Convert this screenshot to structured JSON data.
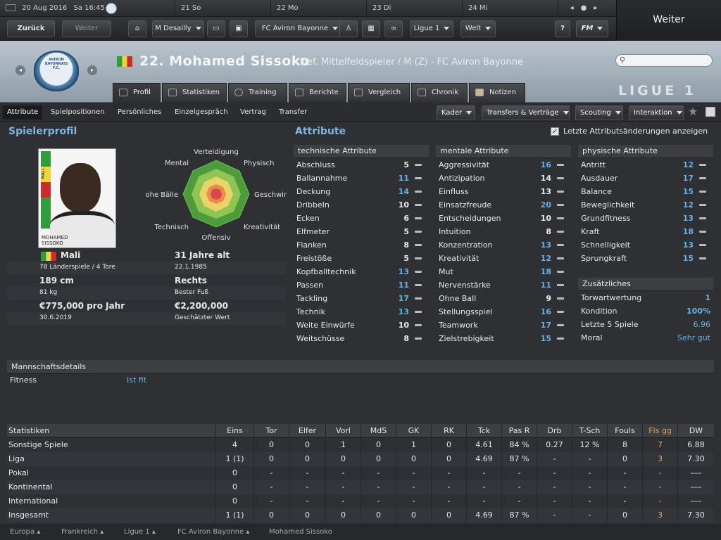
{
  "datebar": {
    "current_date": "20 Aug 2016",
    "current_time": "Sa 16:45",
    "days": [
      "21 So",
      "22 Mo",
      "23 Di",
      "24 Mi"
    ]
  },
  "nav": {
    "back": "Zurück",
    "forward": "Weiter",
    "manager": "M Desailly",
    "club": "FC Aviron Bayonne",
    "league": "Ligue 1",
    "world": "Welt",
    "help": "?",
    "fm": "FM",
    "continue": "Weiter"
  },
  "header": {
    "player_name": "22. Mohamed Sissoko",
    "player_subtitle": "Def. Mittelfeldspieler / M (Z) - FC Aviron Bayonne",
    "ligue": "LIGUE 1",
    "crest_text": "AVIRON BAYONNAIS F.C."
  },
  "tabs": [
    "Profil",
    "Statistiken",
    "Training",
    "Berichte",
    "Vergleich",
    "Chronik",
    "Notizen"
  ],
  "subnav": [
    "Attribute",
    "Spielpositionen",
    "Persönliches",
    "Einzelgespräch",
    "Vertrag",
    "Transfer"
  ],
  "dropdowns": [
    "Kader",
    "Transfers & Verträge",
    "Scouting",
    "Interaktion"
  ],
  "profile": {
    "title": "Spielerprofil",
    "photo_caption_1": "MOHAMED",
    "photo_caption_2": "SISSOKO",
    "photo_flag_text": "MALI",
    "radar_labels": [
      "Verteidigung",
      "Physisch",
      "Geschwir",
      "Kreativität",
      "Offensiv",
      "Technisch",
      "ohe Bälle",
      "Mental"
    ],
    "nation": "Mali",
    "caps": "78 Länderspiele / 4 Tore",
    "age": "31 Jahre alt",
    "dob": "22.1.1985",
    "height": "189 cm",
    "weight": "81 kg",
    "foot": "Rechts",
    "foot_label": "Bester Fuß",
    "wage": "€775,000 pro Jahr",
    "contract_end": "30.6.2019",
    "value": "€2,200,000",
    "value_label": "Geschätzter Wert"
  },
  "attributes": {
    "title": "Attribute",
    "show_changes": "Letzte Attributsänderungen anzeigen",
    "technical_head": "technische Attribute",
    "technical": [
      {
        "name": "Abschluss",
        "value": "5",
        "hi": false
      },
      {
        "name": "Ballannahme",
        "value": "11",
        "hi": true
      },
      {
        "name": "Deckung",
        "value": "14",
        "hi": true
      },
      {
        "name": "Dribbeln",
        "value": "10",
        "hi": false
      },
      {
        "name": "Ecken",
        "value": "6",
        "hi": false
      },
      {
        "name": "Elfmeter",
        "value": "5",
        "hi": false
      },
      {
        "name": "Flanken",
        "value": "8",
        "hi": false
      },
      {
        "name": "Freistöße",
        "value": "5",
        "hi": false
      },
      {
        "name": "Kopfballtechnik",
        "value": "13",
        "hi": true
      },
      {
        "name": "Passen",
        "value": "11",
        "hi": true
      },
      {
        "name": "Tackling",
        "value": "17",
        "hi": true
      },
      {
        "name": "Technik",
        "value": "13",
        "hi": true
      },
      {
        "name": "Weite Einwürfe",
        "value": "10",
        "hi": false
      },
      {
        "name": "Weitschüsse",
        "value": "8",
        "hi": false
      }
    ],
    "mental_head": "mentale Attribute",
    "mental": [
      {
        "name": "Aggressivität",
        "value": "16",
        "hi": true
      },
      {
        "name": "Antizipation",
        "value": "14",
        "hi": false
      },
      {
        "name": "Einfluss",
        "value": "13",
        "hi": false
      },
      {
        "name": "Einsatzfreude",
        "value": "20",
        "hi": true
      },
      {
        "name": "Entscheidungen",
        "value": "10",
        "hi": false
      },
      {
        "name": "Intuition",
        "value": "8",
        "hi": false
      },
      {
        "name": "Konzentration",
        "value": "13",
        "hi": true
      },
      {
        "name": "Kreativität",
        "value": "12",
        "hi": true
      },
      {
        "name": "Mut",
        "value": "18",
        "hi": true
      },
      {
        "name": "Nervenstärke",
        "value": "11",
        "hi": true
      },
      {
        "name": "Ohne Ball",
        "value": "9",
        "hi": false
      },
      {
        "name": "Stellungsspiel",
        "value": "16",
        "hi": true
      },
      {
        "name": "Teamwork",
        "value": "17",
        "hi": true
      },
      {
        "name": "Zielstrebigkeit",
        "value": "15",
        "hi": true
      }
    ],
    "physical_head": "physische Attribute",
    "physical": [
      {
        "name": "Antritt",
        "value": "12",
        "hi": true
      },
      {
        "name": "Ausdauer",
        "value": "17",
        "hi": true
      },
      {
        "name": "Balance",
        "value": "15",
        "hi": true
      },
      {
        "name": "Beweglichkeit",
        "value": "12",
        "hi": true
      },
      {
        "name": "Grundfitness",
        "value": "13",
        "hi": true
      },
      {
        "name": "Kraft",
        "value": "18",
        "hi": true
      },
      {
        "name": "Schnelligkeit",
        "value": "13",
        "hi": true
      },
      {
        "name": "Sprungkraft",
        "value": "15",
        "hi": true
      }
    ],
    "extra_head": "Zusätzliches",
    "extra": [
      {
        "name": "Torwartwertung",
        "value": "1"
      },
      {
        "name": "Kondition",
        "value": "100%"
      },
      {
        "name": "Letzte 5 Spiele",
        "value": "6.96"
      },
      {
        "name": "Moral",
        "value": "Sehr gut"
      }
    ]
  },
  "team": {
    "head": "Mannschaftsdetails",
    "fitness_label": "Fitness",
    "fitness_value": "Ist fit"
  },
  "stats": {
    "columns": [
      "Statistiken",
      "Eins",
      "Tor",
      "Elfer",
      "Vorl",
      "MdS",
      "GK",
      "RK",
      "Tck",
      "Pas R",
      "Drb",
      "T-Sch",
      "Fouls",
      "Fls gg",
      "DW"
    ],
    "rows": [
      [
        "Sonstige Spiele",
        "4",
        "0",
        "0",
        "1",
        "0",
        "1",
        "0",
        "4.61",
        "84 %",
        "0.27",
        "12 %",
        "8",
        "7",
        "6.88"
      ],
      [
        "Liga",
        "1 (1)",
        "0",
        "0",
        "0",
        "0",
        "0",
        "0",
        "4.69",
        "87 %",
        "-",
        "-",
        "0",
        "3",
        "7.30"
      ],
      [
        "Pokal",
        "0",
        "-",
        "-",
        "-",
        "-",
        "-",
        "-",
        "-",
        "-",
        "-",
        "-",
        "-",
        "-",
        "----"
      ],
      [
        "Kontinental",
        "0",
        "-",
        "-",
        "-",
        "-",
        "-",
        "-",
        "-",
        "-",
        "-",
        "-",
        "-",
        "-",
        "----"
      ],
      [
        "International",
        "0",
        "-",
        "-",
        "-",
        "-",
        "-",
        "-",
        "-",
        "-",
        "-",
        "-",
        "-",
        "-",
        "----"
      ],
      [
        "Insgesamt",
        "1 (1)",
        "0",
        "0",
        "0",
        "0",
        "0",
        "0",
        "4.69",
        "87 %",
        "-",
        "-",
        "0",
        "3",
        "7.30"
      ]
    ]
  },
  "footer": [
    "Europa",
    "Frankreich",
    "Ligue 1",
    "FC Aviron Bayonne",
    "Mohamed Sissoko"
  ],
  "colors": {
    "accent": "#63b3ea",
    "fls_gg": "#e0a860"
  }
}
